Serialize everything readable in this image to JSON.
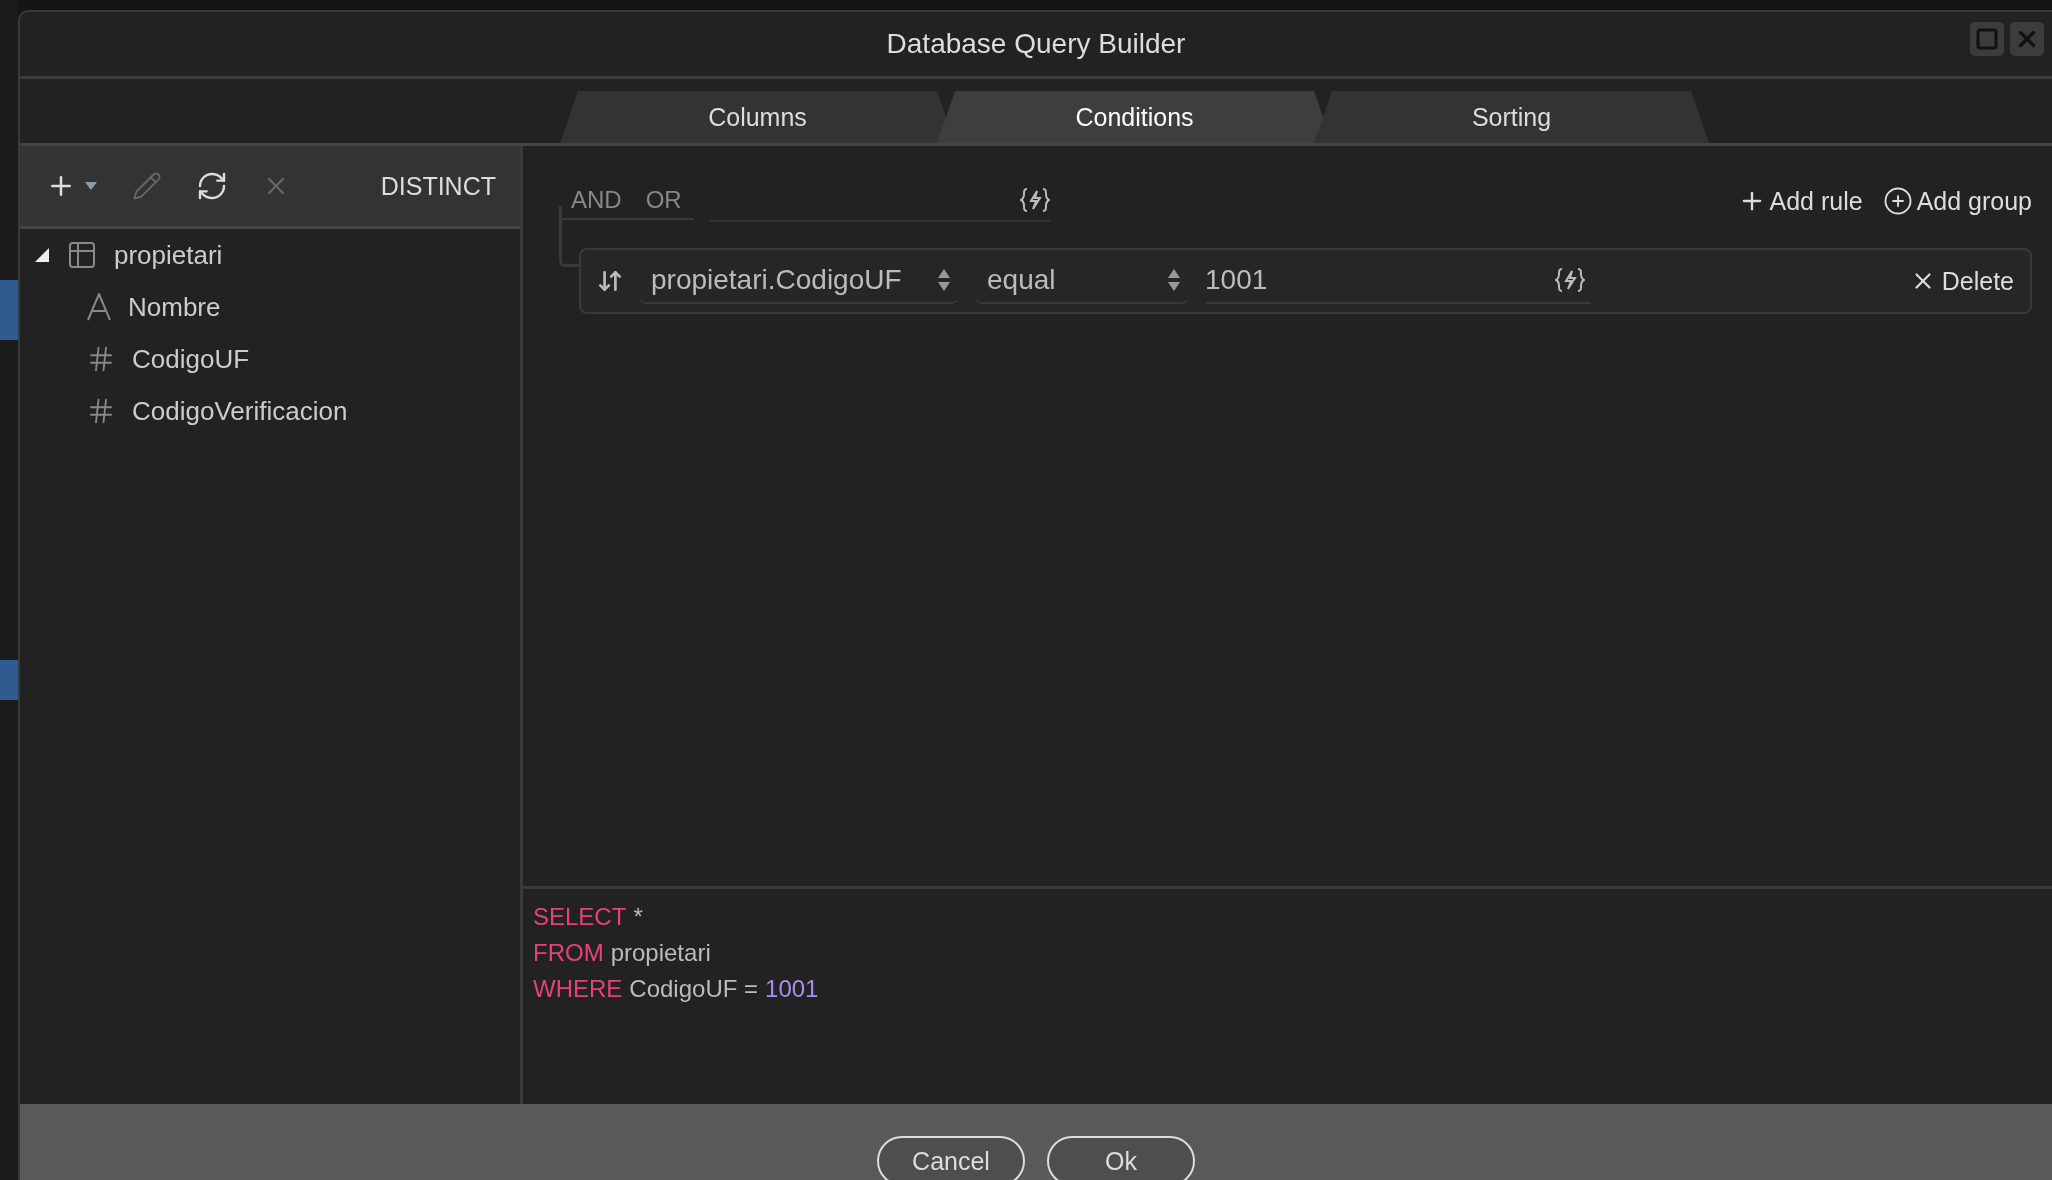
{
  "window": {
    "title": "Database Query Builder"
  },
  "tabs": [
    {
      "label": "Columns",
      "selected": false
    },
    {
      "label": "Conditions",
      "selected": true
    },
    {
      "label": "Sorting",
      "selected": false
    }
  ],
  "toolbar": {
    "tools": [
      {
        "kind": "add",
        "disabled": false
      },
      {
        "kind": "edit",
        "disabled": true
      },
      {
        "kind": "refresh",
        "disabled": false
      },
      {
        "kind": "delete",
        "disabled": true
      }
    ],
    "distinct": "DISTINCT"
  },
  "tree": [
    {
      "label": "propietari",
      "kind": "table",
      "expanded": true,
      "children": [
        {
          "label": "Nombre",
          "kind": "text"
        },
        {
          "label": "CodigoUF",
          "kind": "number"
        },
        {
          "label": "CodigoVerificacion",
          "kind": "number"
        }
      ]
    }
  ],
  "conditions": {
    "logic": [
      "AND",
      "OR"
    ],
    "add_rule": "Add rule",
    "add_group": "Add group",
    "rules": [
      {
        "field": "propietari.CodigoUF",
        "operator": "equal",
        "value": "1001",
        "delete": "Delete"
      }
    ]
  },
  "sql": [
    [
      {
        "kind": "keyword",
        "text": "SELECT"
      },
      {
        "kind": "plain",
        "text": "*"
      }
    ],
    [
      {
        "kind": "keyword",
        "text": "FROM"
      },
      {
        "kind": "plain",
        "text": "propietari"
      }
    ],
    [
      {
        "kind": "keyword",
        "text": "WHERE"
      },
      {
        "kind": "plain",
        "text": "CodigoUF ="
      },
      {
        "kind": "number",
        "text": "1001"
      }
    ]
  ],
  "buttons": [
    "Cancel",
    "Ok"
  ]
}
